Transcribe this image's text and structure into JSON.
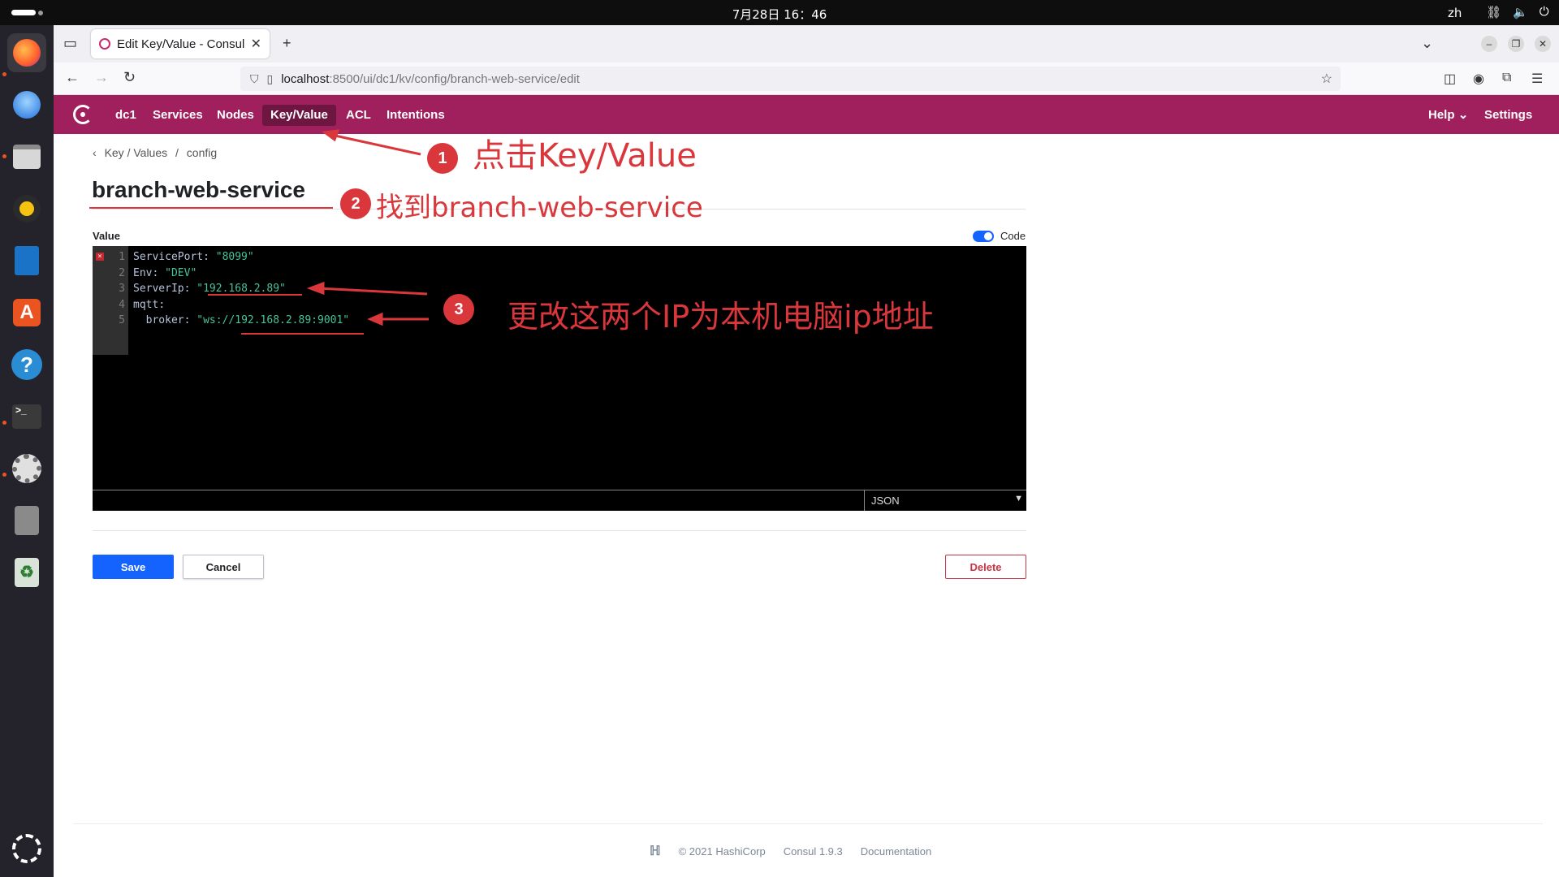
{
  "system": {
    "clock": "7月28日 16：46",
    "lang": "zh"
  },
  "browser": {
    "tab_title": "Edit Key/Value - Consul",
    "url_host": "localhost",
    "url_rest": ":8500/ui/dc1/kv/config/branch-web-service/edit"
  },
  "consul_nav": {
    "items": [
      "dc1",
      "Services",
      "Nodes",
      "Key/Value",
      "ACL",
      "Intentions"
    ],
    "active": "Key/Value",
    "help": "Help",
    "settings": "Settings"
  },
  "page": {
    "breadcrumb": [
      "Key / Values",
      "/",
      "config"
    ],
    "title": "branch-web-service",
    "value_label": "Value",
    "code_toggle_label": "Code",
    "mode": "JSON",
    "save_label": "Save",
    "cancel_label": "Cancel",
    "delete_label": "Delete"
  },
  "code_lines": [
    {
      "n": "1",
      "key": "ServicePort",
      "val": "\"8099\"",
      "indent": ""
    },
    {
      "n": "2",
      "key": "Env",
      "val": "\"DEV\"",
      "indent": ""
    },
    {
      "n": "3",
      "key": "ServerIp",
      "val": "\"192.168.2.89\"",
      "indent": ""
    },
    {
      "n": "4",
      "key": "mqtt",
      "val": "",
      "indent": ""
    },
    {
      "n": "5",
      "key": "broker",
      "val": "\"ws://192.168.2.89:9001\"",
      "indent": "  "
    }
  ],
  "footer": {
    "copyright": "© 2021 HashiCorp",
    "version": "Consul 1.9.3",
    "docs": "Documentation"
  },
  "annotations": {
    "step1": {
      "num": "1",
      "text": "点击Key/Value"
    },
    "step2": {
      "num": "2",
      "text": "找到branch-web-service"
    },
    "step3": {
      "num": "3",
      "text": "更改这两个IP为本机电脑ip地址"
    }
  },
  "colors": {
    "consul_brand": "#a0205e",
    "primary": "#1563ff",
    "annotation": "#d9373b"
  }
}
